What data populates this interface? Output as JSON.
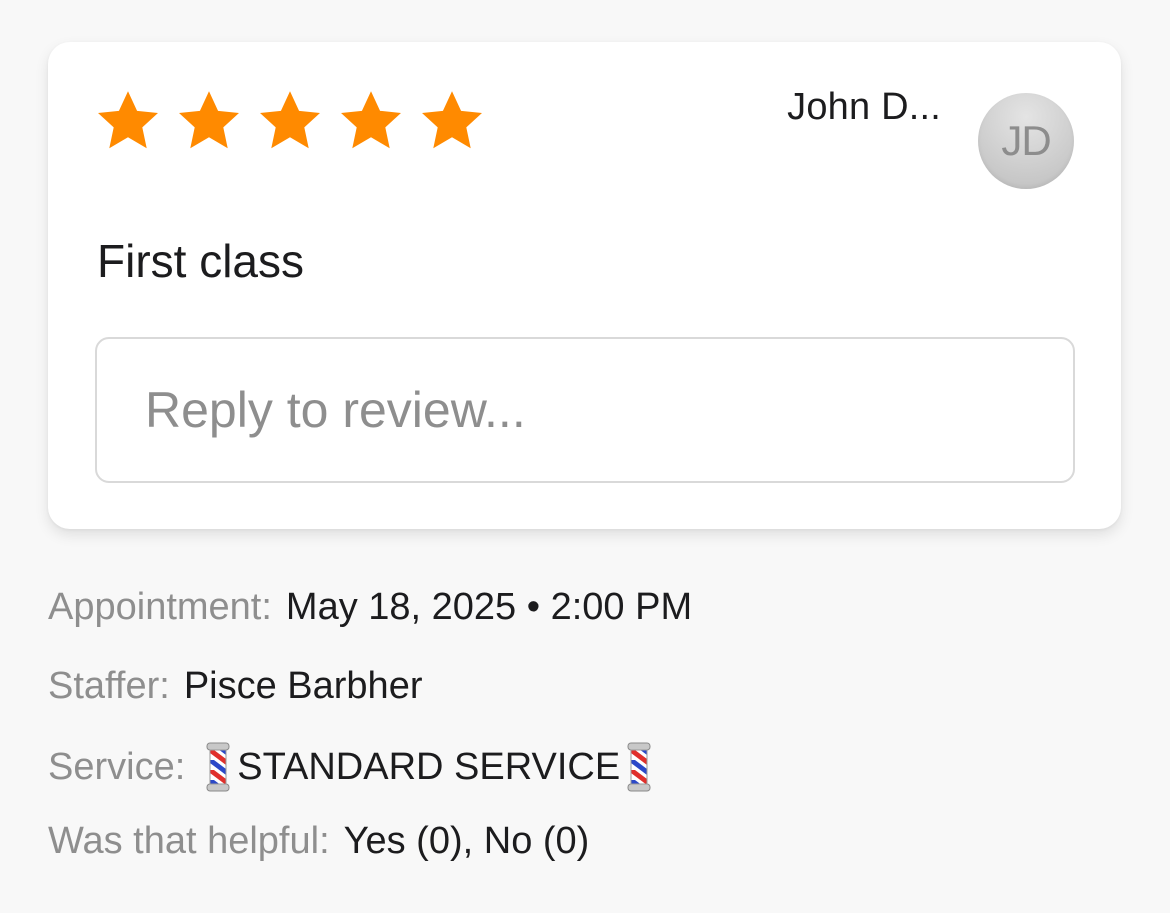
{
  "review": {
    "rating": 5,
    "max_rating": 5,
    "star_color": "#ff8a00",
    "reviewer_name": "John D...",
    "avatar_initials": "JD",
    "text": "First class",
    "reply_placeholder": "Reply to review...",
    "reply_value": ""
  },
  "details": {
    "appointment_label": "Appointment:",
    "appointment_value": "May 18, 2025 • 2:00 PM",
    "staffer_label": "Staffer:",
    "staffer_value": "Pisce Barbher",
    "service_label": "Service:",
    "service_icon": "barber-pole-icon",
    "service_value": "STANDARD SERVICE",
    "helpful_label": "Was that helpful:",
    "helpful_yes": "Yes (0)",
    "helpful_separator": ",",
    "helpful_no": "No (0)"
  }
}
